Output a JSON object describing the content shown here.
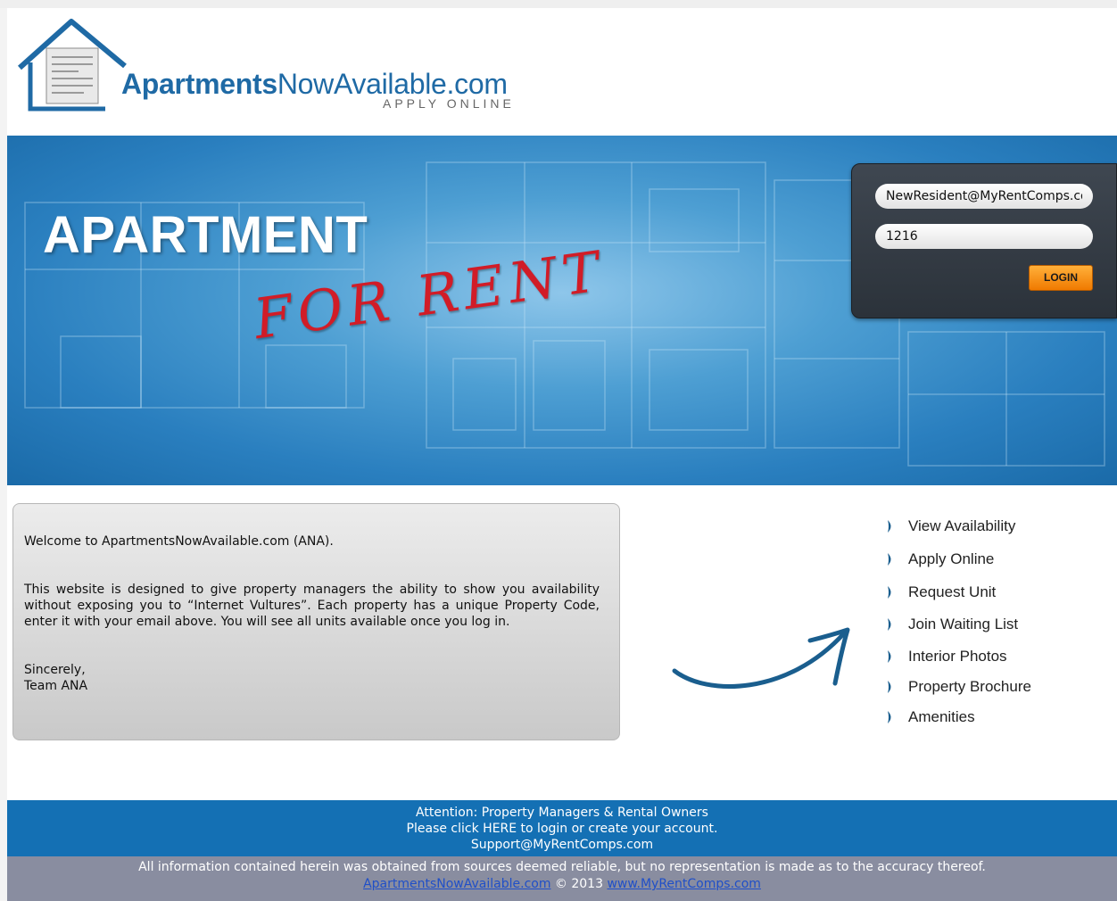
{
  "logo": {
    "brand_bold": "Apartments",
    "brand_rest": "NowAvailable.com",
    "tagline": "APPLY ONLINE"
  },
  "banner": {
    "headline": "APARTMENT",
    "subhead": "FOR RENT"
  },
  "login": {
    "email_value": "NewResident@MyRentComps.com",
    "code_value": "1216",
    "button_label": "LOGIN"
  },
  "welcome": {
    "intro": "Welcome to ApartmentsNowAvailable.com (ANA).",
    "body": "This website is designed to give property managers the ability to show you availability without exposing you to “Internet Vultures”. Each property has a unique Property Code, enter it with your email above. You will see all units available once you log in.",
    "closing": "Sincerely,",
    "signature": "Team ANA"
  },
  "menu": {
    "items": [
      {
        "label": "View Availability"
      },
      {
        "label": "Apply Online"
      },
      {
        "label": "Request Unit"
      },
      {
        "label": "Join Waiting List"
      },
      {
        "label": "Interior Photos"
      },
      {
        "label": "Property Brochure"
      },
      {
        "label": "Amenities"
      }
    ]
  },
  "footer": {
    "line1": "Attention: Property Managers & Rental Owners",
    "line2": "Please click HERE to login or create your account.",
    "line3": "Support@MyRentComps.com",
    "disclaimer": "All information contained herein was obtained from sources deemed reliable, but no representation is made as to the accuracy thereof.",
    "link1": "ApartmentsNowAvailable.com",
    "copyright": " © 2013 ",
    "link2": "www.MyRentComps.com"
  },
  "colors": {
    "brand_blue": "#1f6aa5",
    "banner_blue": "#2a7fbf",
    "login_button": "#f07a00",
    "footer_blue": "#1470b4",
    "footer_gray": "#898da0",
    "for_rent_red": "#d11c27"
  }
}
